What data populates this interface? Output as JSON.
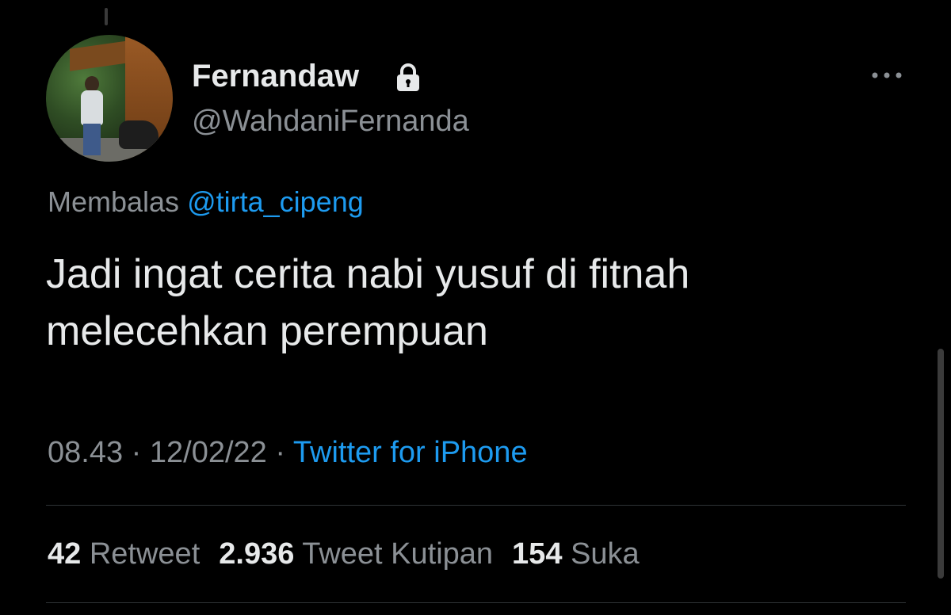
{
  "tweet": {
    "author": {
      "display_name": "Fernandaw",
      "handle": "@WahdaniFernanda",
      "protected_icon": "lock-icon"
    },
    "reply_prefix": "Membalas",
    "reply_to": "@tirta_cipeng",
    "text_line1": "Jadi ingat cerita nabi yusuf di fitnah",
    "text_line2": "melecehkan perempuan",
    "time": "08.43",
    "separator": "·",
    "date": "12/02/22",
    "source": "Twitter for iPhone",
    "stats": {
      "retweets_count": "42",
      "retweets_label": "Retweet",
      "quotes_count": "2.936",
      "quotes_label": "Tweet Kutipan",
      "likes_count": "154",
      "likes_label": "Suka"
    }
  },
  "icons": {
    "more": "more-horizontal-icon",
    "lock": "lock-icon"
  },
  "colors": {
    "background": "#000000",
    "primary_text": "#e7e9ea",
    "secondary_text": "#8b9095",
    "accent": "#1d9bf0",
    "divider": "#2f3336"
  }
}
